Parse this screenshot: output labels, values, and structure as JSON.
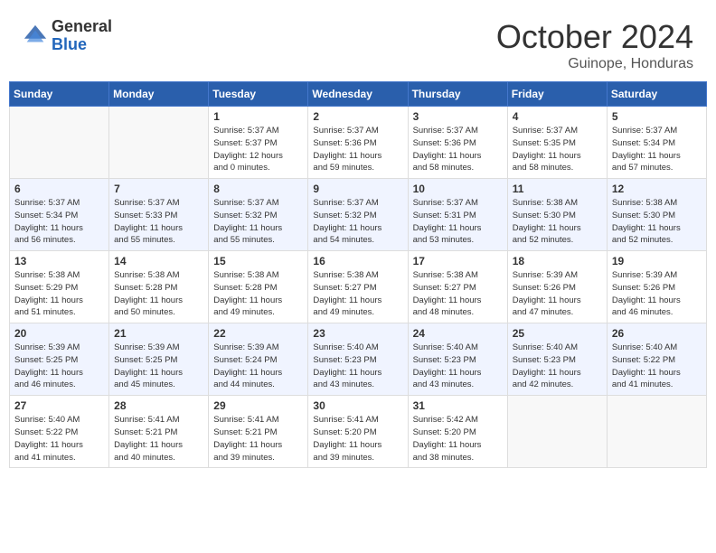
{
  "logo": {
    "general": "General",
    "blue": "Blue"
  },
  "title": {
    "month": "October 2024",
    "location": "Guinope, Honduras"
  },
  "weekdays": [
    "Sunday",
    "Monday",
    "Tuesday",
    "Wednesday",
    "Thursday",
    "Friday",
    "Saturday"
  ],
  "weeks": [
    [
      {
        "day": "",
        "info": ""
      },
      {
        "day": "",
        "info": ""
      },
      {
        "day": "1",
        "info": "Sunrise: 5:37 AM\nSunset: 5:37 PM\nDaylight: 12 hours\nand 0 minutes."
      },
      {
        "day": "2",
        "info": "Sunrise: 5:37 AM\nSunset: 5:36 PM\nDaylight: 11 hours\nand 59 minutes."
      },
      {
        "day": "3",
        "info": "Sunrise: 5:37 AM\nSunset: 5:36 PM\nDaylight: 11 hours\nand 58 minutes."
      },
      {
        "day": "4",
        "info": "Sunrise: 5:37 AM\nSunset: 5:35 PM\nDaylight: 11 hours\nand 58 minutes."
      },
      {
        "day": "5",
        "info": "Sunrise: 5:37 AM\nSunset: 5:34 PM\nDaylight: 11 hours\nand 57 minutes."
      }
    ],
    [
      {
        "day": "6",
        "info": "Sunrise: 5:37 AM\nSunset: 5:34 PM\nDaylight: 11 hours\nand 56 minutes."
      },
      {
        "day": "7",
        "info": "Sunrise: 5:37 AM\nSunset: 5:33 PM\nDaylight: 11 hours\nand 55 minutes."
      },
      {
        "day": "8",
        "info": "Sunrise: 5:37 AM\nSunset: 5:32 PM\nDaylight: 11 hours\nand 55 minutes."
      },
      {
        "day": "9",
        "info": "Sunrise: 5:37 AM\nSunset: 5:32 PM\nDaylight: 11 hours\nand 54 minutes."
      },
      {
        "day": "10",
        "info": "Sunrise: 5:37 AM\nSunset: 5:31 PM\nDaylight: 11 hours\nand 53 minutes."
      },
      {
        "day": "11",
        "info": "Sunrise: 5:38 AM\nSunset: 5:30 PM\nDaylight: 11 hours\nand 52 minutes."
      },
      {
        "day": "12",
        "info": "Sunrise: 5:38 AM\nSunset: 5:30 PM\nDaylight: 11 hours\nand 52 minutes."
      }
    ],
    [
      {
        "day": "13",
        "info": "Sunrise: 5:38 AM\nSunset: 5:29 PM\nDaylight: 11 hours\nand 51 minutes."
      },
      {
        "day": "14",
        "info": "Sunrise: 5:38 AM\nSunset: 5:28 PM\nDaylight: 11 hours\nand 50 minutes."
      },
      {
        "day": "15",
        "info": "Sunrise: 5:38 AM\nSunset: 5:28 PM\nDaylight: 11 hours\nand 49 minutes."
      },
      {
        "day": "16",
        "info": "Sunrise: 5:38 AM\nSunset: 5:27 PM\nDaylight: 11 hours\nand 49 minutes."
      },
      {
        "day": "17",
        "info": "Sunrise: 5:38 AM\nSunset: 5:27 PM\nDaylight: 11 hours\nand 48 minutes."
      },
      {
        "day": "18",
        "info": "Sunrise: 5:39 AM\nSunset: 5:26 PM\nDaylight: 11 hours\nand 47 minutes."
      },
      {
        "day": "19",
        "info": "Sunrise: 5:39 AM\nSunset: 5:26 PM\nDaylight: 11 hours\nand 46 minutes."
      }
    ],
    [
      {
        "day": "20",
        "info": "Sunrise: 5:39 AM\nSunset: 5:25 PM\nDaylight: 11 hours\nand 46 minutes."
      },
      {
        "day": "21",
        "info": "Sunrise: 5:39 AM\nSunset: 5:25 PM\nDaylight: 11 hours\nand 45 minutes."
      },
      {
        "day": "22",
        "info": "Sunrise: 5:39 AM\nSunset: 5:24 PM\nDaylight: 11 hours\nand 44 minutes."
      },
      {
        "day": "23",
        "info": "Sunrise: 5:40 AM\nSunset: 5:23 PM\nDaylight: 11 hours\nand 43 minutes."
      },
      {
        "day": "24",
        "info": "Sunrise: 5:40 AM\nSunset: 5:23 PM\nDaylight: 11 hours\nand 43 minutes."
      },
      {
        "day": "25",
        "info": "Sunrise: 5:40 AM\nSunset: 5:23 PM\nDaylight: 11 hours\nand 42 minutes."
      },
      {
        "day": "26",
        "info": "Sunrise: 5:40 AM\nSunset: 5:22 PM\nDaylight: 11 hours\nand 41 minutes."
      }
    ],
    [
      {
        "day": "27",
        "info": "Sunrise: 5:40 AM\nSunset: 5:22 PM\nDaylight: 11 hours\nand 41 minutes."
      },
      {
        "day": "28",
        "info": "Sunrise: 5:41 AM\nSunset: 5:21 PM\nDaylight: 11 hours\nand 40 minutes."
      },
      {
        "day": "29",
        "info": "Sunrise: 5:41 AM\nSunset: 5:21 PM\nDaylight: 11 hours\nand 39 minutes."
      },
      {
        "day": "30",
        "info": "Sunrise: 5:41 AM\nSunset: 5:20 PM\nDaylight: 11 hours\nand 39 minutes."
      },
      {
        "day": "31",
        "info": "Sunrise: 5:42 AM\nSunset: 5:20 PM\nDaylight: 11 hours\nand 38 minutes."
      },
      {
        "day": "",
        "info": ""
      },
      {
        "day": "",
        "info": ""
      }
    ]
  ]
}
